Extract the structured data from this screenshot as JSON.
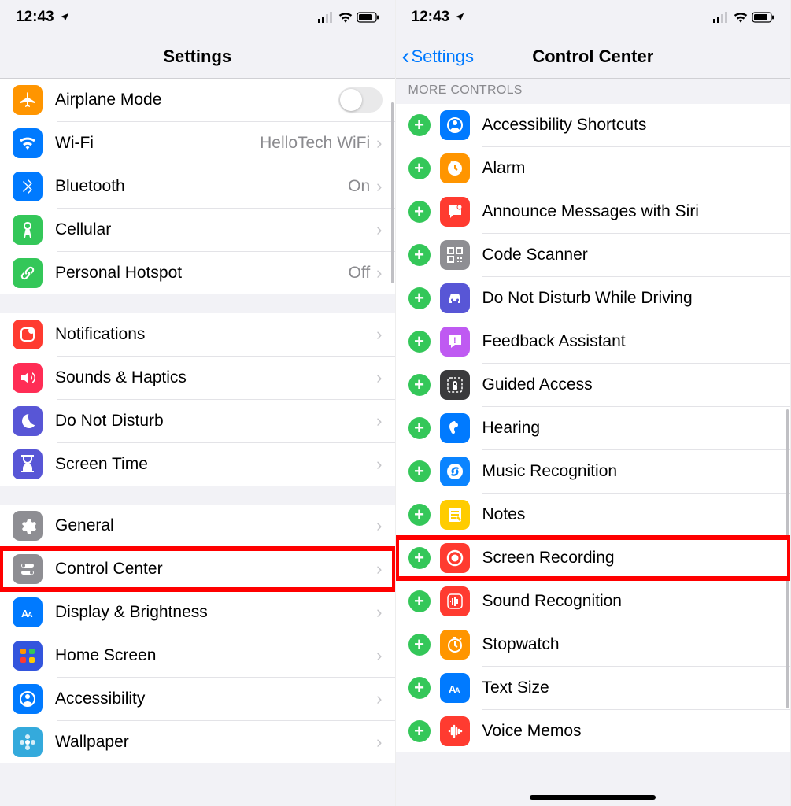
{
  "status": {
    "time": "12:43"
  },
  "left": {
    "title": "Settings",
    "groups": [
      {
        "rows": [
          {
            "name": "airplane-mode",
            "label": "Airplane Mode",
            "iconColor": "#ff9500",
            "icon": "airplane",
            "toggle": true,
            "toggleOn": false
          },
          {
            "name": "wifi",
            "label": "Wi-Fi",
            "value": "HelloTech WiFi",
            "iconColor": "#007aff",
            "icon": "wifi",
            "chevron": true
          },
          {
            "name": "bluetooth",
            "label": "Bluetooth",
            "value": "On",
            "iconColor": "#007aff",
            "icon": "bluetooth",
            "chevron": true
          },
          {
            "name": "cellular",
            "label": "Cellular",
            "iconColor": "#34c759",
            "icon": "antenna",
            "chevron": true
          },
          {
            "name": "personal-hotspot",
            "label": "Personal Hotspot",
            "value": "Off",
            "iconColor": "#34c759",
            "icon": "link",
            "chevron": true
          }
        ]
      },
      {
        "rows": [
          {
            "name": "notifications",
            "label": "Notifications",
            "iconColor": "#ff3b30",
            "icon": "notif",
            "chevron": true
          },
          {
            "name": "sounds-haptics",
            "label": "Sounds & Haptics",
            "iconColor": "#ff2d55",
            "icon": "sound",
            "chevron": true
          },
          {
            "name": "do-not-disturb",
            "label": "Do Not Disturb",
            "iconColor": "#5856d6",
            "icon": "moon",
            "chevron": true
          },
          {
            "name": "screen-time",
            "label": "Screen Time",
            "iconColor": "#5856d6",
            "icon": "hourglass",
            "chevron": true
          }
        ]
      },
      {
        "rows": [
          {
            "name": "general",
            "label": "General",
            "iconColor": "#8e8e93",
            "icon": "gear",
            "chevron": true
          },
          {
            "name": "control-center",
            "label": "Control Center",
            "iconColor": "#8e8e93",
            "icon": "switches",
            "chevron": true,
            "highlight": true
          },
          {
            "name": "display-brightness",
            "label": "Display & Brightness",
            "iconColor": "#007aff",
            "icon": "aa",
            "chevron": true
          },
          {
            "name": "home-screen",
            "label": "Home Screen",
            "iconColor": "#3355dd",
            "icon": "grid",
            "chevron": true
          },
          {
            "name": "accessibility",
            "label": "Accessibility",
            "iconColor": "#007aff",
            "icon": "person",
            "chevron": true
          },
          {
            "name": "wallpaper",
            "label": "Wallpaper",
            "iconColor": "#34aadc",
            "icon": "flower",
            "chevron": true
          }
        ]
      }
    ]
  },
  "right": {
    "backLabel": "Settings",
    "title": "Control Center",
    "sectionHeader": "MORE CONTROLS",
    "rows": [
      {
        "name": "accessibility-shortcuts",
        "label": "Accessibility Shortcuts",
        "iconColor": "#007aff",
        "icon": "person"
      },
      {
        "name": "alarm",
        "label": "Alarm",
        "iconColor": "#ff9500",
        "icon": "clock"
      },
      {
        "name": "announce-messages",
        "label": "Announce Messages with Siri",
        "iconColor": "#ff3b30",
        "icon": "bubble"
      },
      {
        "name": "code-scanner",
        "label": "Code Scanner",
        "iconColor": "#8e8e93",
        "icon": "qr"
      },
      {
        "name": "dnd-driving",
        "label": "Do Not Disturb While Driving",
        "iconColor": "#5856d6",
        "icon": "car"
      },
      {
        "name": "feedback-assistant",
        "label": "Feedback Assistant",
        "iconColor": "#bf5af2",
        "icon": "feedback"
      },
      {
        "name": "guided-access",
        "label": "Guided Access",
        "iconColor": "#3a3a3c",
        "icon": "lock"
      },
      {
        "name": "hearing",
        "label": "Hearing",
        "iconColor": "#007aff",
        "icon": "ear"
      },
      {
        "name": "music-recognition",
        "label": "Music Recognition",
        "iconColor": "#0a84ff",
        "icon": "shazam"
      },
      {
        "name": "notes",
        "label": "Notes",
        "iconColor": "#ffcc00",
        "icon": "note"
      },
      {
        "name": "screen-recording",
        "label": "Screen Recording",
        "iconColor": "#ff3b30",
        "icon": "record",
        "highlight": true
      },
      {
        "name": "sound-recognition",
        "label": "Sound Recognition",
        "iconColor": "#ff3b30",
        "icon": "wave"
      },
      {
        "name": "stopwatch",
        "label": "Stopwatch",
        "iconColor": "#ff9500",
        "icon": "stopwatch"
      },
      {
        "name": "text-size",
        "label": "Text Size",
        "iconColor": "#007aff",
        "icon": "aa"
      },
      {
        "name": "voice-memos",
        "label": "Voice Memos",
        "iconColor": "#ff3b30",
        "icon": "voice"
      }
    ]
  }
}
